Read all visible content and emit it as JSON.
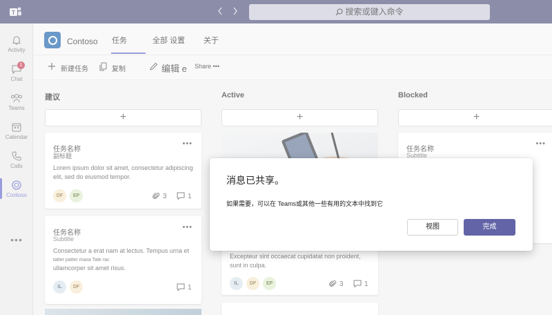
{
  "topbar": {
    "search_placeholder": "搜索或键入命令",
    "back_icon": "chevron-left-icon",
    "forward_icon": "chevron-right-icon"
  },
  "rail": {
    "items": [
      {
        "label": "Activity",
        "icon": "bell-icon"
      },
      {
        "label": "Chat",
        "icon": "chat-icon",
        "badge": "1"
      },
      {
        "label": "Teams",
        "icon": "teams-icon"
      },
      {
        "label": "Calendar",
        "icon": "calendar-icon"
      },
      {
        "label": "Calls",
        "icon": "phone-icon"
      },
      {
        "label": "Contoso",
        "icon": "contoso-icon",
        "active": true
      }
    ],
    "more": "•••"
  },
  "app": {
    "name": "Contoso",
    "tabs": [
      "任务",
      "全部 设置",
      "关于"
    ]
  },
  "toolbar": {
    "new_task": "新建任务",
    "copy": "复制",
    "edit": "编辑 e",
    "share": "Share •••"
  },
  "columns": [
    {
      "title": "建议"
    },
    {
      "title": "Active"
    },
    {
      "title": "Blocked"
    }
  ],
  "cards": {
    "c1": {
      "title": "任务名称",
      "subtitle": "副标题",
      "desc": "Lorem ipsum dolor sit amet, consectetur adipiscing elit, sed do eiusmod tempor.",
      "avatars": [
        "DF",
        "EP"
      ],
      "attachments": "3",
      "comments": "1"
    },
    "c2": {
      "title": "任务名称",
      "subtitle": "Subtitle",
      "desc_line1": "Consectetur a erat nam at lectus. Tempus urna et",
      "desc_line2": "tatter patter masa Tate rac",
      "desc_line3": "ullamcorper sit amet risus.",
      "avatars": [
        "IL",
        "DF"
      ],
      "comments": "1"
    },
    "c3": {
      "desc": "Excepteur sint occaecat cupidatat non proident, sunt in culpa.",
      "avatars": [
        "IL",
        "DF",
        "EP"
      ],
      "attachments": "3",
      "comments": "1"
    },
    "c4": {
      "title": "任务名称",
      "subtitle": "Subtitle"
    }
  },
  "dialog": {
    "title": "消息已共享。",
    "body": "如果需要，可以在 Teams或其他一些有用的文本中找到它",
    "view_button": "视图",
    "done_button": "完成"
  },
  "colors": {
    "topbar": "#464775",
    "accent": "#5b5fc7",
    "primary_button": "#6264a7",
    "badge": "#c4314b"
  }
}
